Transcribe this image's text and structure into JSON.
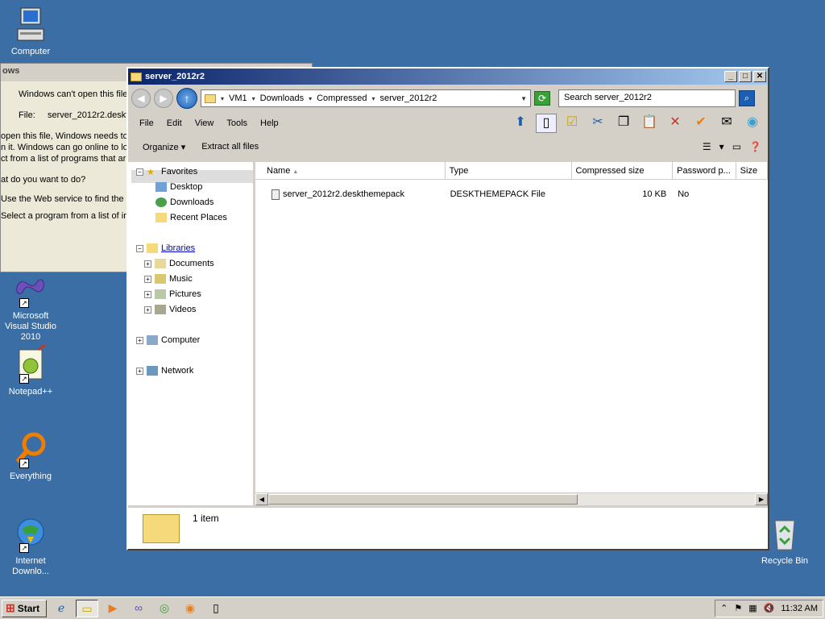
{
  "desktop": {
    "icons": [
      {
        "label": "Computer"
      },
      {
        "label": "Microsoft Visual Studio 2010"
      },
      {
        "label": "Notepad++"
      },
      {
        "label": "Everything"
      },
      {
        "label": "Internet Downlo..."
      },
      {
        "label": "Recycle Bin"
      }
    ]
  },
  "bg_dialog": {
    "title": "ows",
    "line1": "Windows can't open this file",
    "file_label": "File:",
    "file_value": "server_2012r2.deskt",
    "line3": "open this file, Windows needs to",
    "line4": "n it. Windows can go online to loo",
    "line5": "ct from a list of programs that ar",
    "line6": "at do you want to do?",
    "line7": "Use the Web service to find the c",
    "line8": "Select a program from a list of ins"
  },
  "window": {
    "title": "server_2012r2",
    "controls": {
      "minimize": "_",
      "maximize": "□",
      "close": "✕"
    },
    "address": {
      "crumbs": [
        "VM1",
        "Downloads",
        "Compressed",
        "server_2012r2"
      ],
      "search_placeholder": "Search server_2012r2"
    },
    "menu": [
      "File",
      "Edit",
      "View",
      "Tools",
      "Help"
    ],
    "commands": {
      "organize": "Organize",
      "extract": "Extract all files"
    },
    "nav": {
      "favorites": "Favorites",
      "desktop": "Desktop",
      "downloads": "Downloads",
      "recent": "Recent Places",
      "libraries": "Libraries",
      "documents": "Documents",
      "music": "Music",
      "pictures": "Pictures",
      "videos": "Videos",
      "computer": "Computer",
      "network": "Network"
    },
    "columns": [
      "Name",
      "Type",
      "Compressed size",
      "Password p...",
      "Size"
    ],
    "rows": [
      {
        "name": "server_2012r2.deskthemepack",
        "type": "DESKTHEMEPACK File",
        "compressed": "10 KB",
        "password": "No",
        "size": ""
      }
    ],
    "status": "1 item"
  },
  "taskbar": {
    "start": "Start",
    "time": "11:32 AM"
  },
  "colors": {
    "desktop": "#3a6ea5",
    "titlebar": "#0a246a"
  }
}
